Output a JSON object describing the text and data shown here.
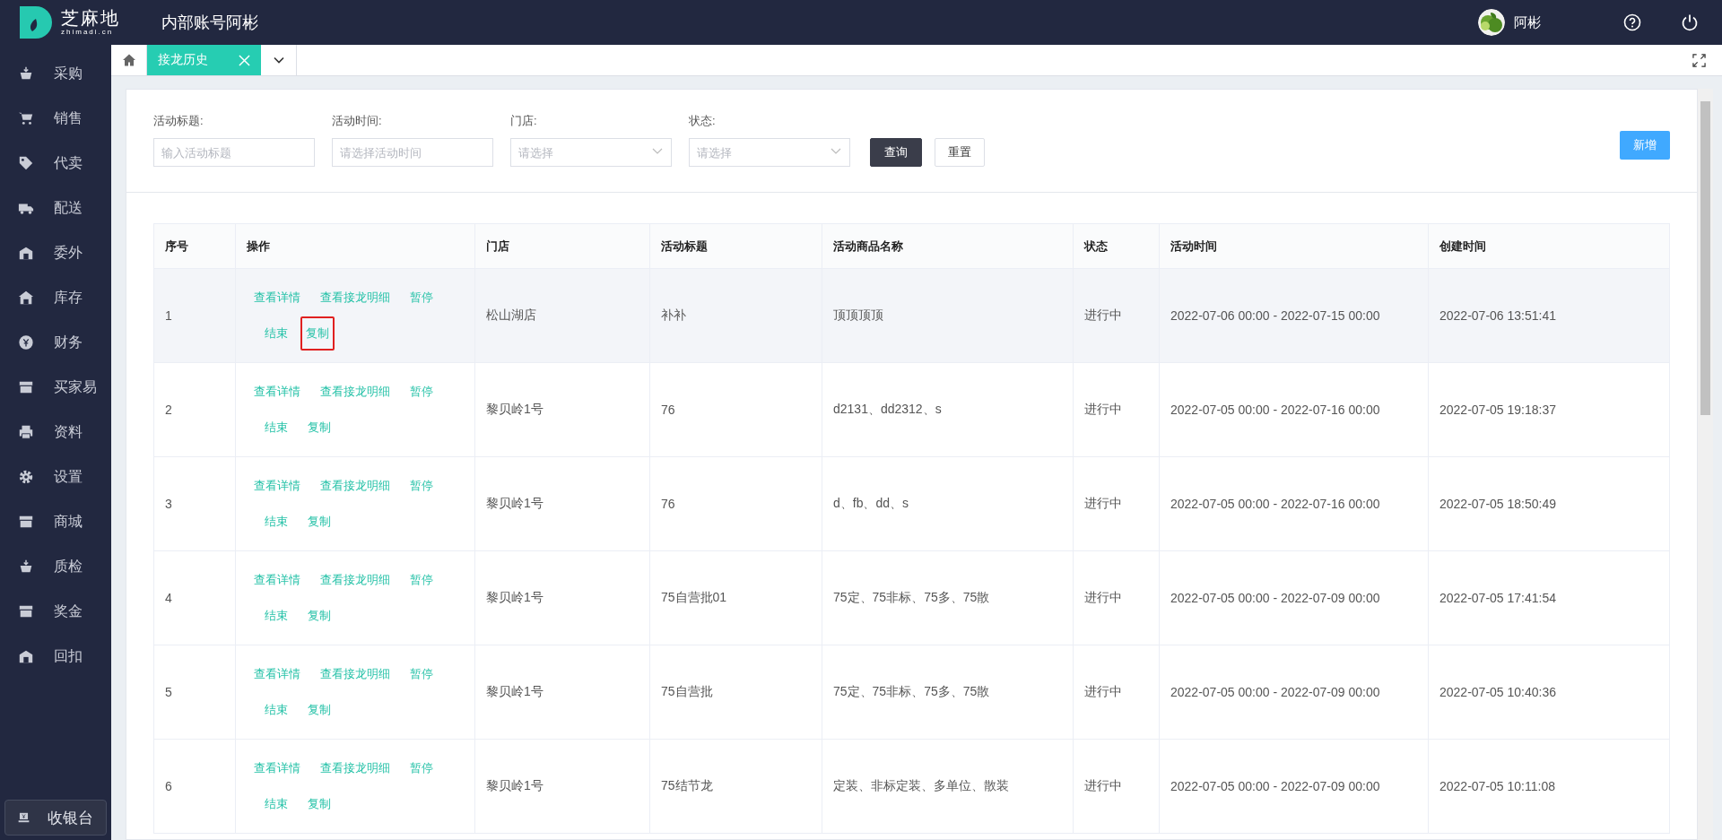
{
  "header": {
    "logo_text": "芝麻地",
    "logo_sub": "zhimadi.cn",
    "account": "内部账号阿彬",
    "user": "阿彬"
  },
  "sidebar": {
    "items": [
      {
        "label": "采购",
        "selected": false
      },
      {
        "label": "销售",
        "selected": false
      },
      {
        "label": "代卖",
        "selected": false
      },
      {
        "label": "配送",
        "selected": false
      },
      {
        "label": "委外",
        "selected": false
      },
      {
        "label": "库存",
        "selected": false
      },
      {
        "label": "财务",
        "selected": false
      },
      {
        "label": "买家易",
        "selected": false
      },
      {
        "label": "资料",
        "selected": false
      },
      {
        "label": "设置",
        "selected": false
      },
      {
        "label": "商城",
        "selected": false
      },
      {
        "label": "质检",
        "selected": false
      },
      {
        "label": "奖金",
        "selected": false
      },
      {
        "label": "回扣",
        "selected": false
      }
    ],
    "cashier": "收银台"
  },
  "tabs": [
    {
      "label": "接龙历史",
      "selected": true
    }
  ],
  "filters": [
    {
      "kind": "input",
      "label": "活动标题:",
      "placeholder": "输入活动标题"
    },
    {
      "kind": "input",
      "label": "活动时间:",
      "placeholder": "请选择活动时间"
    },
    {
      "kind": "select",
      "label": "门店:",
      "placeholder": "请选择"
    },
    {
      "kind": "select",
      "label": "状态:",
      "placeholder": "请选择"
    }
  ],
  "filter_buttons": [
    {
      "label": "查询",
      "kind": "primary"
    },
    {
      "label": "重置",
      "kind": "plain"
    }
  ],
  "add_button": "新增",
  "table": {
    "columns": [
      "序号",
      "操作",
      "门店",
      "活动标题",
      "活动商品名称",
      "状态",
      "活动时间",
      "创建时间"
    ],
    "rows": [
      {
        "selected": true,
        "no": "1",
        "actions": [
          {
            "label": "查看详情",
            "annotated": false
          },
          {
            "label": "查看接龙明细",
            "annotated": false
          },
          {
            "label": "暂停",
            "annotated": false
          },
          {
            "label": "结束",
            "annotated": false
          },
          {
            "label": "复制",
            "annotated": true
          }
        ],
        "store": "松山湖店",
        "title": "补补",
        "goods": "顶顶顶顶",
        "status": "进行中",
        "period": "2022-07-06 00:00 - 2022-07-15 00:00",
        "created": "2022-07-06 13:51:41"
      },
      {
        "selected": false,
        "no": "2",
        "actions": [
          {
            "label": "查看详情",
            "annotated": false
          },
          {
            "label": "查看接龙明细",
            "annotated": false
          },
          {
            "label": "暂停",
            "annotated": false
          },
          {
            "label": "结束",
            "annotated": false
          },
          {
            "label": "复制",
            "annotated": false
          }
        ],
        "store": "黎贝岭1号",
        "title": "76",
        "goods": "d2131、dd2312、s",
        "status": "进行中",
        "period": "2022-07-05 00:00 - 2022-07-16 00:00",
        "created": "2022-07-05 19:18:37"
      },
      {
        "selected": false,
        "no": "3",
        "actions": [
          {
            "label": "查看详情",
            "annotated": false
          },
          {
            "label": "查看接龙明细",
            "annotated": false
          },
          {
            "label": "暂停",
            "annotated": false
          },
          {
            "label": "结束",
            "annotated": false
          },
          {
            "label": "复制",
            "annotated": false
          }
        ],
        "store": "黎贝岭1号",
        "title": "76",
        "goods": "d、fb、dd、s",
        "status": "进行中",
        "period": "2022-07-05 00:00 - 2022-07-16 00:00",
        "created": "2022-07-05 18:50:49"
      },
      {
        "selected": false,
        "no": "4",
        "actions": [
          {
            "label": "查看详情",
            "annotated": false
          },
          {
            "label": "查看接龙明细",
            "annotated": false
          },
          {
            "label": "暂停",
            "annotated": false
          },
          {
            "label": "结束",
            "annotated": false
          },
          {
            "label": "复制",
            "annotated": false
          }
        ],
        "store": "黎贝岭1号",
        "title": "75自营批01",
        "goods": "75定、75非标、75多、75散",
        "status": "进行中",
        "period": "2022-07-05 00:00 - 2022-07-09 00:00",
        "created": "2022-07-05 17:41:54"
      },
      {
        "selected": false,
        "no": "5",
        "actions": [
          {
            "label": "查看详情",
            "annotated": false
          },
          {
            "label": "查看接龙明细",
            "annotated": false
          },
          {
            "label": "暂停",
            "annotated": false
          },
          {
            "label": "结束",
            "annotated": false
          },
          {
            "label": "复制",
            "annotated": false
          }
        ],
        "store": "黎贝岭1号",
        "title": "75自营批",
        "goods": "75定、75非标、75多、75散",
        "status": "进行中",
        "period": "2022-07-05 00:00 - 2022-07-09 00:00",
        "created": "2022-07-05 10:40:36"
      },
      {
        "selected": false,
        "no": "6",
        "actions": [
          {
            "label": "查看详情",
            "annotated": false
          },
          {
            "label": "查看接龙明细",
            "annotated": false
          },
          {
            "label": "暂停",
            "annotated": false
          },
          {
            "label": "结束",
            "annotated": false
          },
          {
            "label": "复制",
            "annotated": false
          }
        ],
        "store": "黎贝岭1号",
        "title": "75结节龙",
        "goods": "定装、非标定装、多单位、散装",
        "status": "进行中",
        "period": "2022-07-05 00:00 - 2022-07-09 00:00",
        "created": "2022-07-05 10:11:08"
      }
    ]
  }
}
